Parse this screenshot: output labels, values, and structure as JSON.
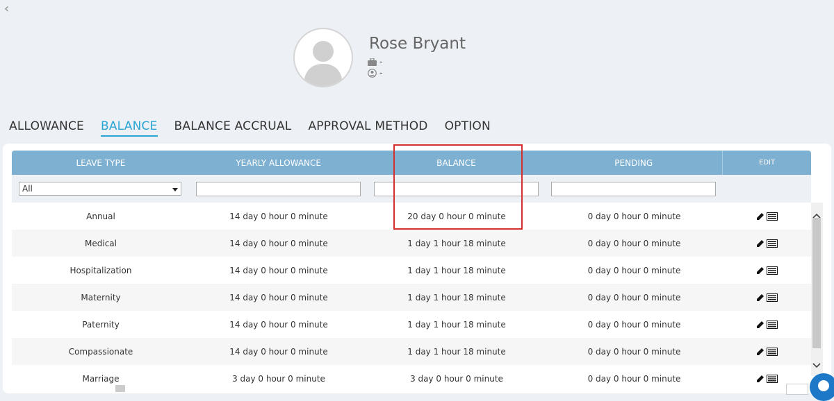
{
  "nav": {
    "back_glyph": "‹"
  },
  "profile": {
    "name": "Rose Bryant",
    "job_title": "-",
    "user_role": "-"
  },
  "tabs": [
    {
      "label": "ALLOWANCE",
      "active": false
    },
    {
      "label": "BALANCE",
      "active": true
    },
    {
      "label": "BALANCE ACCRUAL",
      "active": false
    },
    {
      "label": "APPROVAL METHOD",
      "active": false
    },
    {
      "label": "OPTION",
      "active": false
    }
  ],
  "table": {
    "headers": [
      "LEAVE TYPE",
      "YEARLY ALLOWANCE",
      "BALANCE",
      "PENDING",
      "EDIT"
    ],
    "filter": {
      "leave_type_selected": "All"
    },
    "rows": [
      {
        "leave_type": "Annual",
        "yearly_allowance": "14 day 0 hour 0 minute",
        "balance": "20 day 0 hour 0 minute",
        "pending": "0 day 0 hour 0 minute"
      },
      {
        "leave_type": "Medical",
        "yearly_allowance": "14 day 0 hour 0 minute",
        "balance": "1 day 1 hour 18 minute",
        "pending": "0 day 0 hour 0 minute"
      },
      {
        "leave_type": "Hospitalization",
        "yearly_allowance": "14 day 0 hour 0 minute",
        "balance": "1 day 1 hour 18 minute",
        "pending": "0 day 0 hour 0 minute"
      },
      {
        "leave_type": "Maternity",
        "yearly_allowance": "14 day 0 hour 0 minute",
        "balance": "1 day 1 hour 18 minute",
        "pending": "0 day 0 hour 0 minute"
      },
      {
        "leave_type": "Paternity",
        "yearly_allowance": "14 day 0 hour 0 minute",
        "balance": "1 day 1 hour 18 minute",
        "pending": "0 day 0 hour 0 minute"
      },
      {
        "leave_type": "Compassionate",
        "yearly_allowance": "14 day 0 hour 0 minute",
        "balance": "1 day 1 hour 18 minute",
        "pending": "0 day 0 hour 0 minute"
      },
      {
        "leave_type": "Marriage",
        "yearly_allowance": "3 day 0 hour 0 minute",
        "balance": "3 day 0 hour 0 minute",
        "pending": "0 day 0 hour 0 minute"
      }
    ]
  },
  "icons": {
    "edit": "pencil-icon",
    "detail": "list-icon"
  },
  "colors": {
    "accent": "#2aa6d4",
    "table_header": "#7eb0d2",
    "highlight": "#d32f2f",
    "background": "#edf0f4"
  }
}
